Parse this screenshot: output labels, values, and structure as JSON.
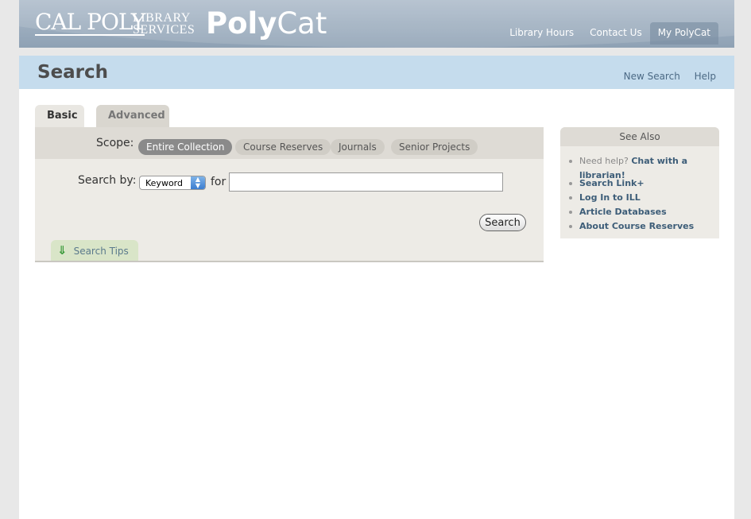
{
  "header": {
    "cal_poly": "CAL POLY",
    "library_line1": "LIBRARY",
    "library_line2": "SERVICES",
    "polycat_bold": "Poly",
    "polycat_light": "Cat",
    "nav": [
      {
        "label": "Library Hours"
      },
      {
        "label": "Contact Us"
      },
      {
        "label": "My PolyCat"
      }
    ]
  },
  "titlebar": {
    "title": "Search",
    "links": [
      "New Search",
      "Help"
    ]
  },
  "tabs": {
    "basic": "Basic",
    "advanced": "Advanced"
  },
  "scope": {
    "label": "Scope:",
    "options": [
      "Entire Collection",
      "Course Reserves",
      "Journals",
      "Senior Projects"
    ],
    "selected": "Entire Collection"
  },
  "search": {
    "by_label": "Search by:",
    "by_value": "Keyword",
    "for_label": "for",
    "query": "",
    "button": "Search",
    "tips": "Search Tips"
  },
  "see_also": {
    "title": "See Also",
    "help_prefix": "Need help?",
    "help_link": "Chat with a librarian!",
    "links": [
      "Search Link+",
      "Log In to ILL",
      "Article Databases",
      "About Course Reserves"
    ]
  }
}
